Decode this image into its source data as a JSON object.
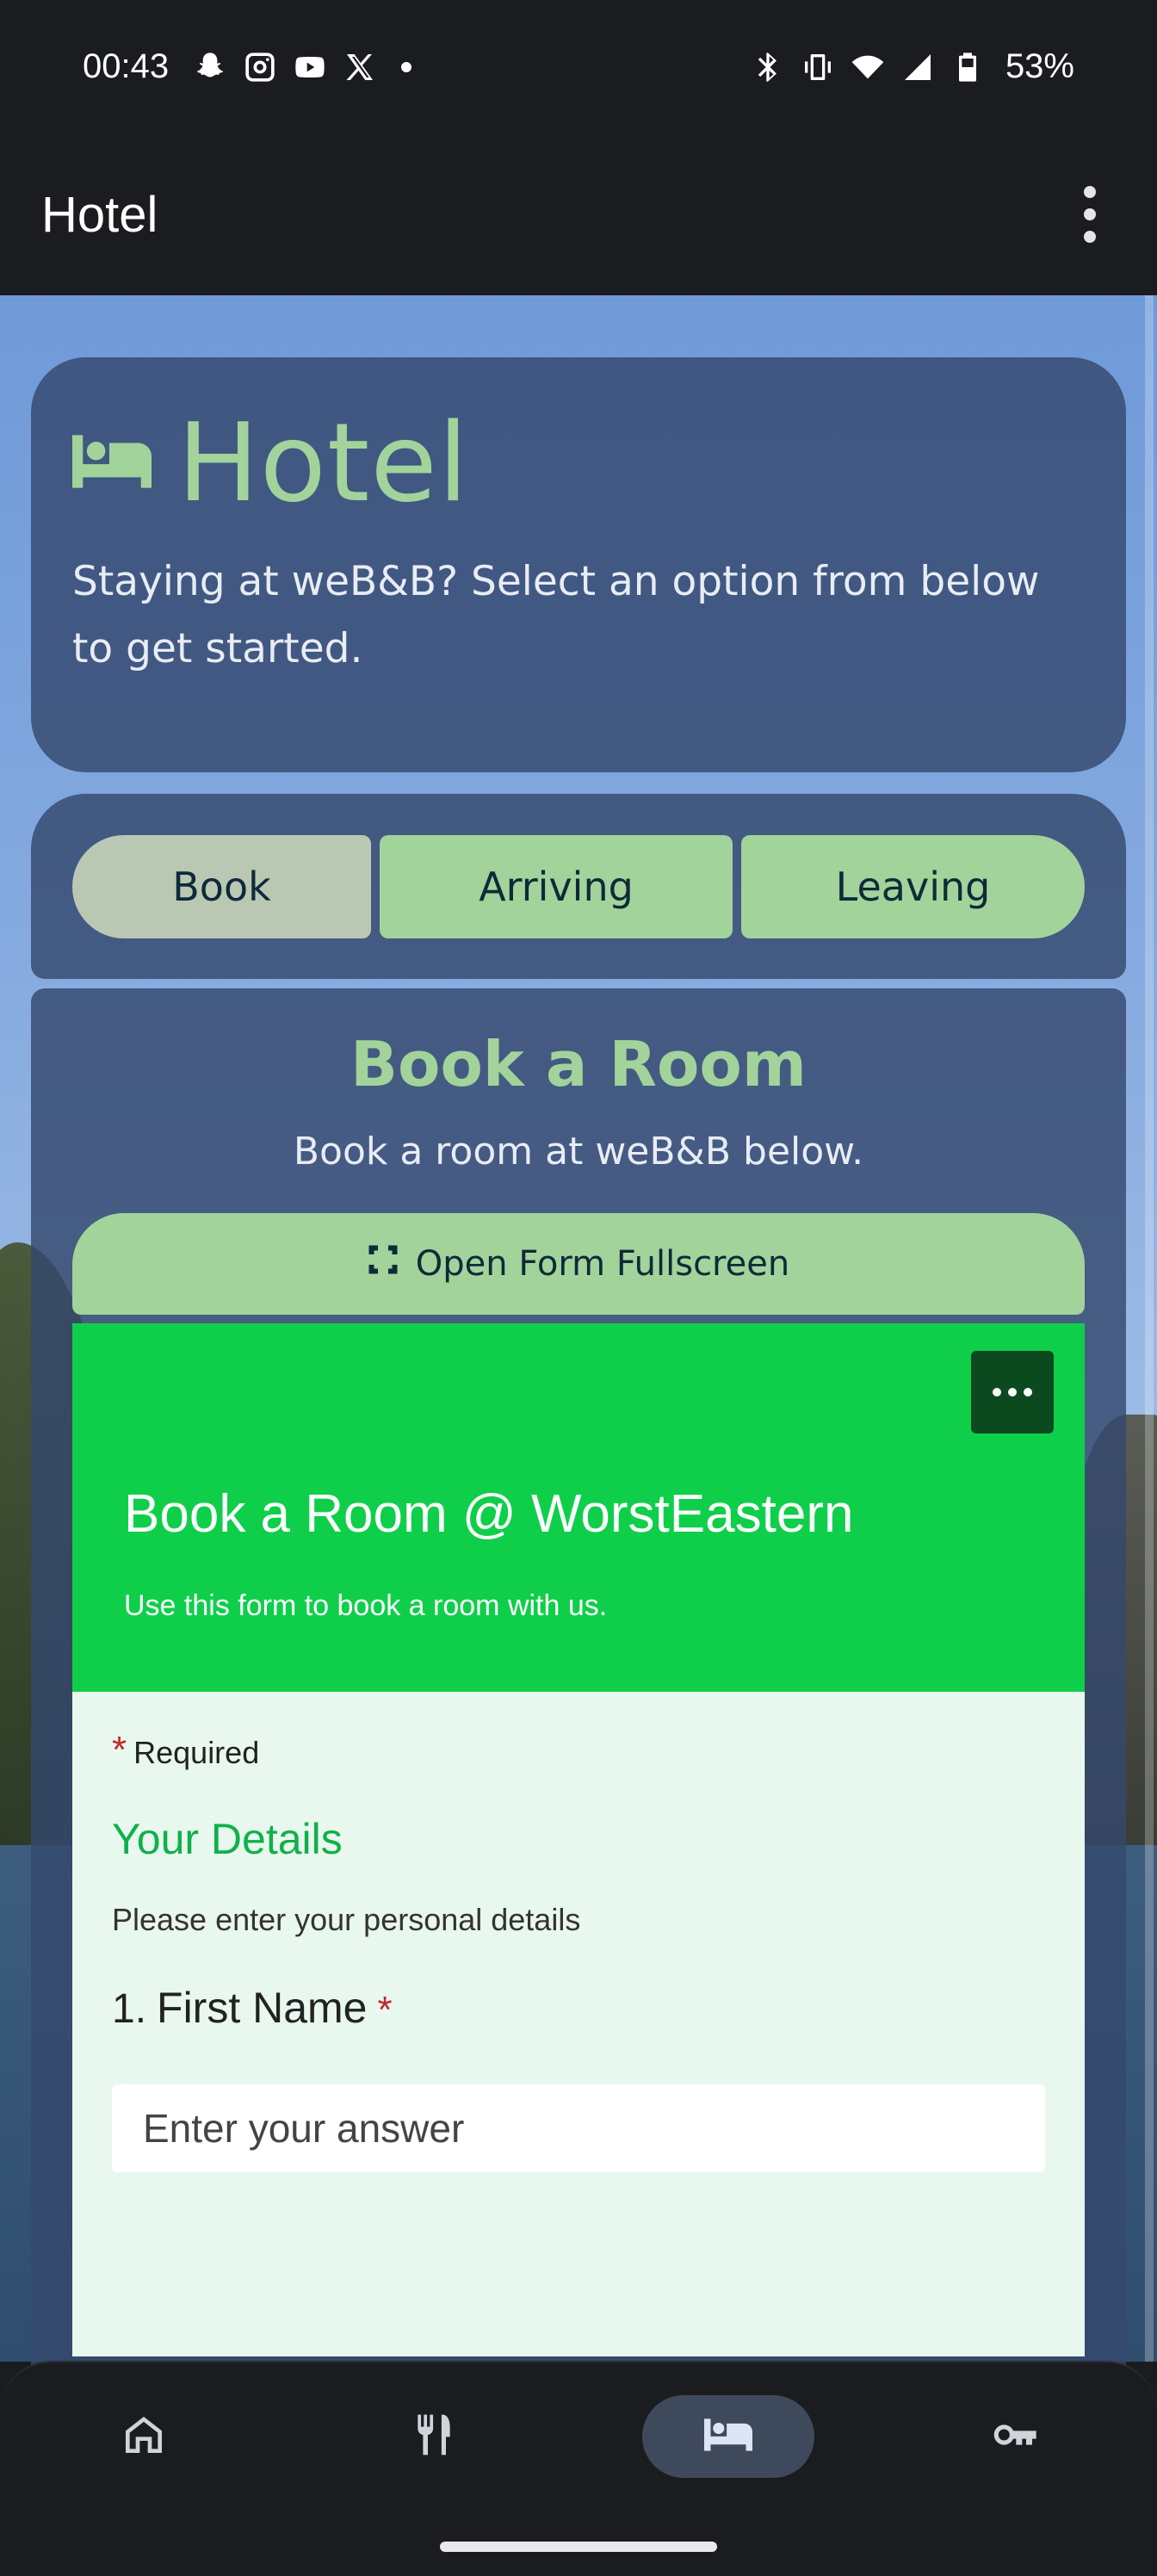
{
  "status_bar": {
    "time": "00:43",
    "battery_percent": "53%",
    "notification_icons": [
      "snapchat-icon",
      "instagram-icon",
      "youtube-icon",
      "x-icon"
    ],
    "system_icons": [
      "bluetooth-icon",
      "vibrate-icon",
      "wifi-icon",
      "signal-icon",
      "battery-icon"
    ]
  },
  "app_bar": {
    "title": "Hotel"
  },
  "hero": {
    "title": "Hotel",
    "description": "Staying at weB&B? Select an option from below to get started."
  },
  "tabs": [
    {
      "label": "Book",
      "selected": true
    },
    {
      "label": "Arriving",
      "selected": false
    },
    {
      "label": "Leaving",
      "selected": false
    }
  ],
  "booking": {
    "title": "Book a Room",
    "subtitle": "Book a room at weB&B below.",
    "fullscreen_label": "Open Form Fullscreen"
  },
  "form": {
    "title": "Book a Room @ WorstEastern",
    "description": "Use this form to book a room with us.",
    "required_note": "Required",
    "section_title": "Your Details",
    "section_description": "Please enter your personal details",
    "question_number": "1.",
    "question_label": "First Name",
    "answer_placeholder": "Enter your answer"
  },
  "bottom_nav": [
    {
      "icon": "home-icon",
      "selected": false
    },
    {
      "icon": "restaurant-icon",
      "selected": false
    },
    {
      "icon": "bed-icon",
      "selected": true
    },
    {
      "icon": "key-icon",
      "selected": false
    }
  ],
  "colors": {
    "accent_green": "#a2d39a",
    "form_header_green": "#0fcf4a",
    "card_blue": "#34486e",
    "required_red": "#c0282d"
  }
}
